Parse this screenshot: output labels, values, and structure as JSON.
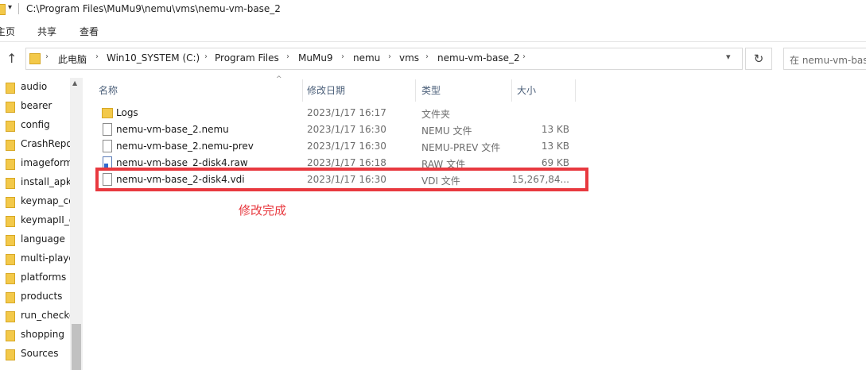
{
  "window": {
    "title": "C:\\Program Files\\MuMu9\\nemu\\vms\\nemu-vm-base_2"
  },
  "ribbon": {
    "tabs": [
      "主页",
      "共享",
      "查看"
    ]
  },
  "address": {
    "crumbs": [
      "此电脑",
      "Win10_SYSTEM (C:)",
      "Program Files",
      "MuMu9",
      "nemu",
      "vms",
      "nemu-vm-base_2"
    ]
  },
  "search": {
    "placeholder": "在 nemu-vm-bas"
  },
  "nav": {
    "items": [
      "audio",
      "bearer",
      "config",
      "CrashRepo",
      "imageform",
      "install_apk",
      "keymap_co",
      "keymapII_c",
      "language",
      "multi-playe",
      "platforms",
      "products",
      "run_checke",
      "shopping",
      "Sources"
    ]
  },
  "columns": {
    "name": "名称",
    "date": "修改日期",
    "type": "类型",
    "size": "大小"
  },
  "files": [
    {
      "name": "Logs",
      "date": "2023/1/17 16:17",
      "type": "文件夹",
      "size": "",
      "icon": "folder-icon"
    },
    {
      "name": "nemu-vm-base_2.nemu",
      "date": "2023/1/17 16:30",
      "type": "NEMU 文件",
      "size": "13 KB",
      "icon": "file-icon"
    },
    {
      "name": "nemu-vm-base_2.nemu-prev",
      "date": "2023/1/17 16:30",
      "type": "NEMU-PREV 文件",
      "size": "13 KB",
      "icon": "file-icon"
    },
    {
      "name": "nemu-vm-base_2-disk4.raw",
      "date": "2023/1/17 16:18",
      "type": "RAW 文件",
      "size": "69 KB",
      "icon": "raw-file-icon"
    },
    {
      "name": "nemu-vm-base_2-disk4.vdi",
      "date": "2023/1/17 16:30",
      "type": "VDI 文件",
      "size": "15,267,84...",
      "icon": "file-icon"
    }
  ],
  "annotation": {
    "text": "修改完成",
    "color": "#e8393f"
  }
}
